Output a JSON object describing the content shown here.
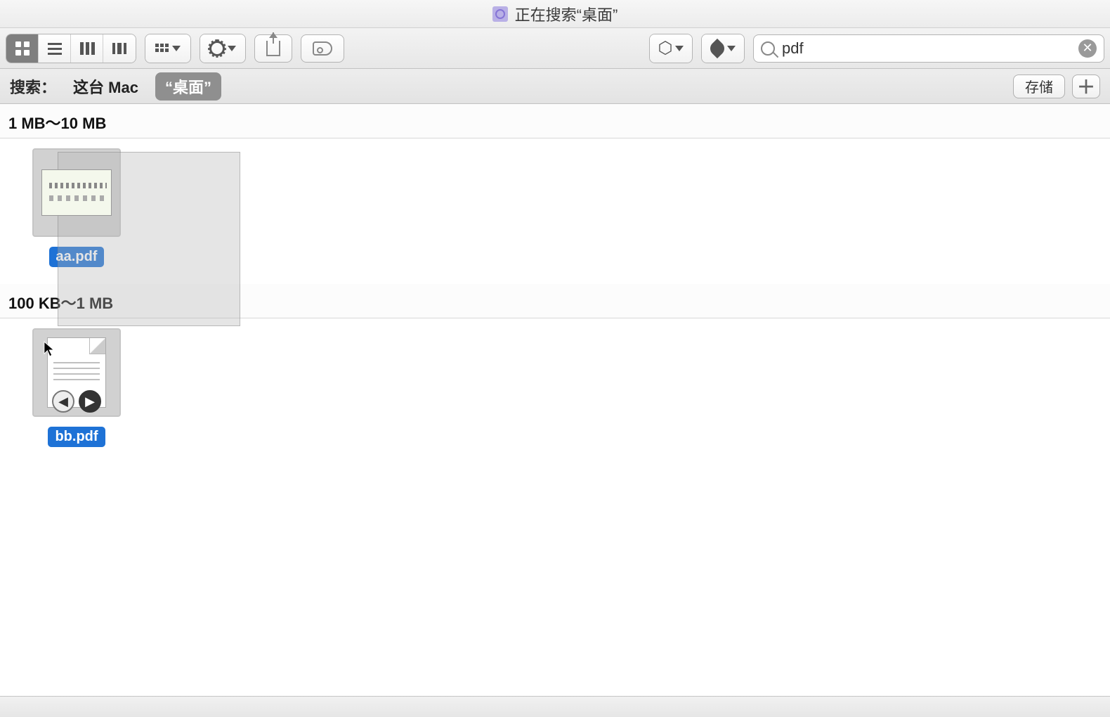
{
  "window": {
    "title": "正在搜索“桌面”"
  },
  "toolbar": {
    "view_modes": [
      "icon",
      "list",
      "column",
      "gallery"
    ],
    "active_view": "icon"
  },
  "search": {
    "query": "pdf"
  },
  "scope": {
    "label": "搜索：",
    "options": {
      "this_mac": "这台 Mac",
      "desktop": "“桌面”"
    },
    "active": "desktop",
    "save_label": "存储"
  },
  "groups": [
    {
      "header": "1 MB～10 MB",
      "files": [
        {
          "name": "aa.pdf",
          "thumb": "cad"
        }
      ]
    },
    {
      "header": "100 KB～1 MB",
      "files": [
        {
          "name": "bb.pdf",
          "thumb": "doc"
        }
      ]
    }
  ],
  "colors": {
    "selection": "#1e72d6"
  }
}
